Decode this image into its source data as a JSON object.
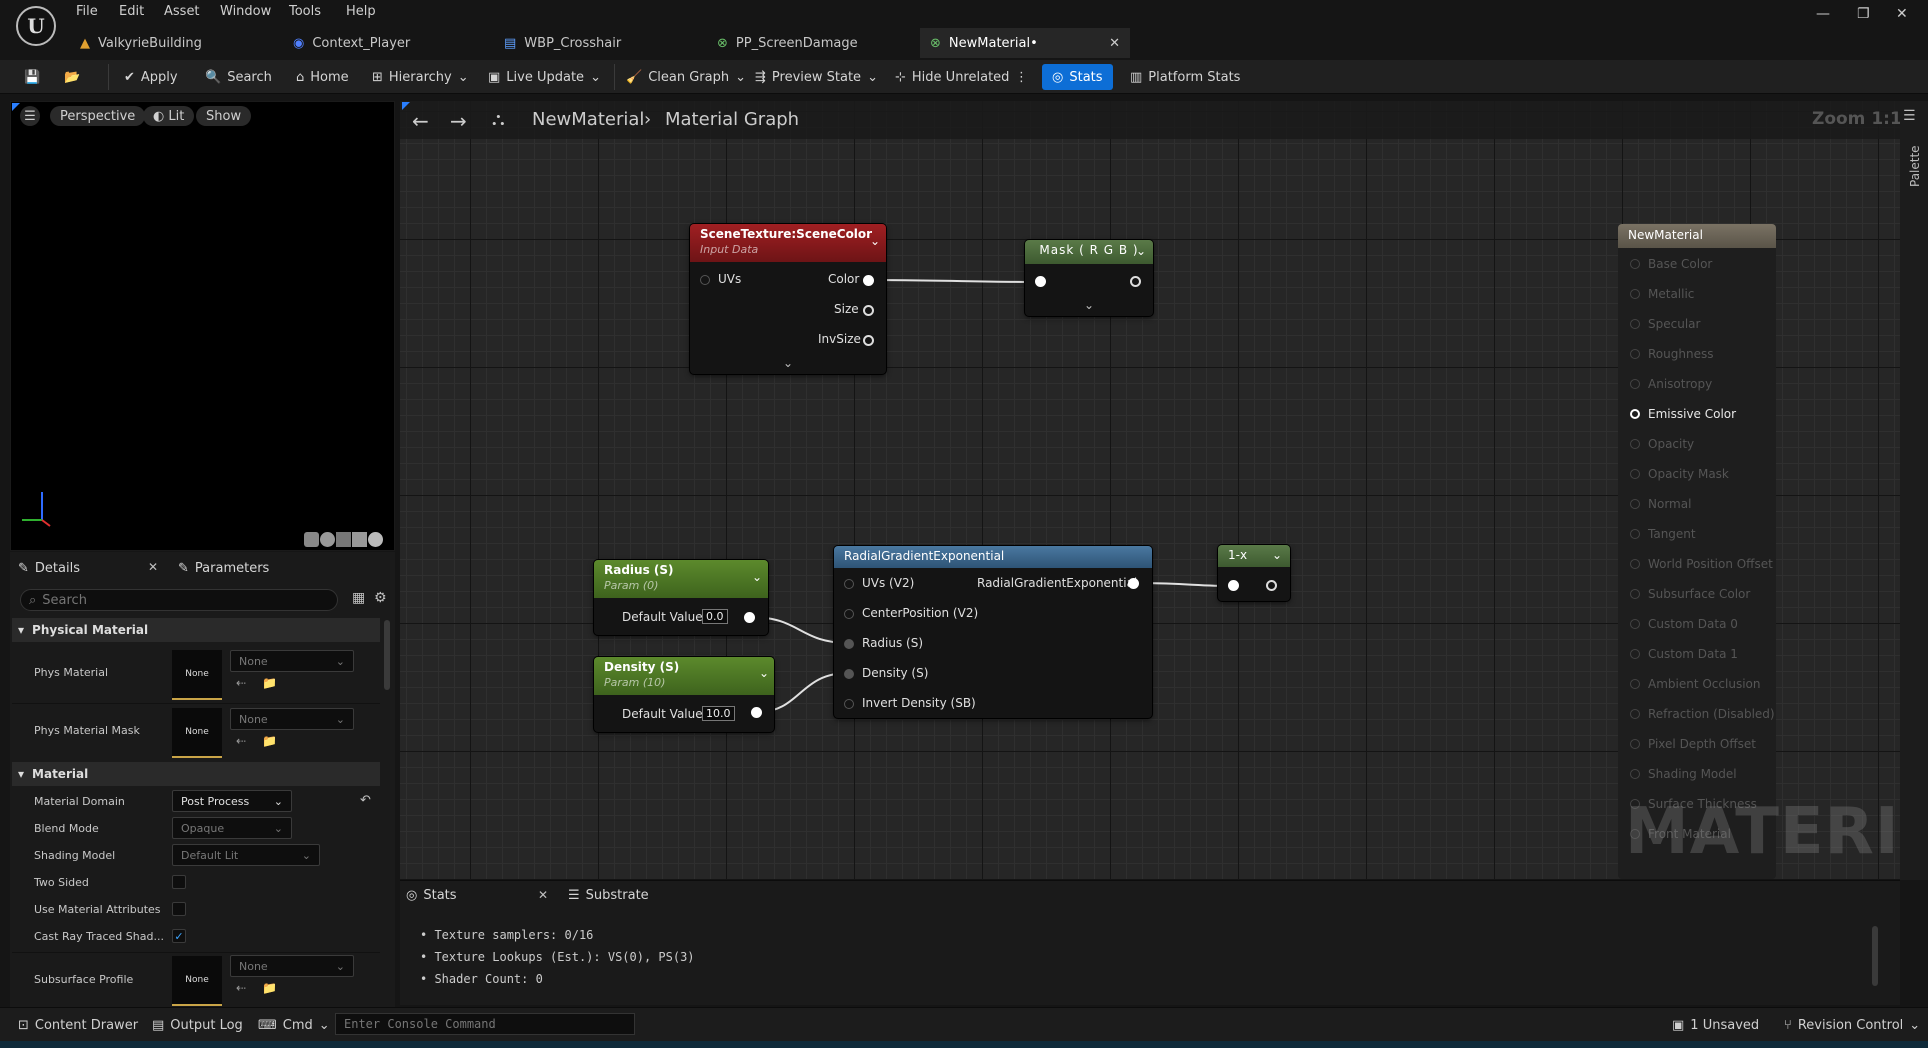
{
  "menu": [
    "File",
    "Edit",
    "Asset",
    "Window",
    "Tools",
    "Help"
  ],
  "tabs": [
    {
      "label": "ValkyrieBuilding"
    },
    {
      "label": "Context_Player"
    },
    {
      "label": "WBP_Crosshair"
    },
    {
      "label": "PP_ScreenDamage"
    },
    {
      "label": "NewMaterial•"
    }
  ],
  "toolbar": {
    "apply": "Apply",
    "search": "Search",
    "home": "Home",
    "hierarchy": "Hierarchy",
    "live_update": "Live Update",
    "clean_graph": "Clean Graph",
    "preview_state": "Preview State",
    "hide_unrelated": "Hide Unrelated",
    "stats": "Stats",
    "platform_stats": "Platform Stats"
  },
  "viewport": {
    "perspective": "Perspective",
    "lit": "Lit",
    "show": "Show"
  },
  "details": {
    "tab_details": "Details",
    "tab_parameters": "Parameters",
    "search_placeholder": "Search",
    "cat_physical": "Physical Material",
    "phys_material": "Phys Material",
    "phys_material_mask": "Phys Material Mask",
    "none": "None",
    "cat_material": "Material",
    "material_domain": "Material Domain",
    "material_domain_value": "Post Process",
    "blend_mode": "Blend Mode",
    "blend_mode_value": "Opaque",
    "shading_model": "Shading Model",
    "shading_model_value": "Default Lit",
    "two_sided": "Two Sided",
    "use_material_attributes": "Use Material Attributes",
    "cast_ray": "Cast Ray Traced Shad...",
    "subsurface_profile": "Subsurface Profile"
  },
  "graph": {
    "breadcrumb_asset": "NewMaterial",
    "breadcrumb_graph": "Material Graph",
    "zoom": "Zoom 1:1",
    "palette": "Palette",
    "scene_texture": {
      "title": "SceneTexture:SceneColor",
      "subtitle": "Input Data",
      "in_uvs": "UVs",
      "out_color": "Color",
      "out_size": "Size",
      "out_invsize": "InvSize"
    },
    "mask": {
      "title": "Mask ( R G B )"
    },
    "radius": {
      "title": "Radius (S)",
      "subtitle": "Param (0)",
      "default_label": "Default Value",
      "value": "0.0"
    },
    "density": {
      "title": "Density (S)",
      "subtitle": "Param (10)",
      "default_label": "Default Value",
      "value": "10.0"
    },
    "radial": {
      "title": "RadialGradientExponential",
      "pins": [
        "UVs (V2)",
        "CenterPosition (V2)",
        "Radius (S)",
        "Density (S)",
        "Invert Density (SB)"
      ],
      "output": "RadialGradientExponential"
    },
    "oneminus": {
      "title": "1-x"
    },
    "output_node": {
      "title": "NewMaterial",
      "pins": [
        "Base Color",
        "Metallic",
        "Specular",
        "Roughness",
        "Anisotropy",
        "Emissive Color",
        "Opacity",
        "Opacity Mask",
        "Normal",
        "Tangent",
        "World Position Offset",
        "Subsurface Color",
        "Custom Data 0",
        "Custom Data 1",
        "Ambient Occlusion",
        "Refraction (Disabled)",
        "Pixel Depth Offset",
        "Shading Model",
        "Surface Thickness",
        "Front Material"
      ],
      "active_pin": "Emissive Color"
    },
    "watermark": "MATERIAL"
  },
  "stats_panel": {
    "tab_stats": "Stats",
    "tab_substrate": "Substrate",
    "lines": [
      "• Texture samplers: 0/16",
      "• Texture Lookups (Est.): VS(0), PS(3)",
      "• Shader Count: 0"
    ]
  },
  "statusbar": {
    "content_drawer": "Content Drawer",
    "output_log": "Output Log",
    "cmd": "Cmd",
    "console_placeholder": "Enter Console Command",
    "unsaved": "1 Unsaved",
    "revision_control": "Revision Control"
  },
  "colors": {
    "accent": "#0d6ed6",
    "scene_texture_head": "#8f1b1e",
    "mask_head": "#4b6b3a",
    "param_head": "#4d7a2a",
    "function_head": "#3c6487",
    "output_head": "#6b6357"
  }
}
